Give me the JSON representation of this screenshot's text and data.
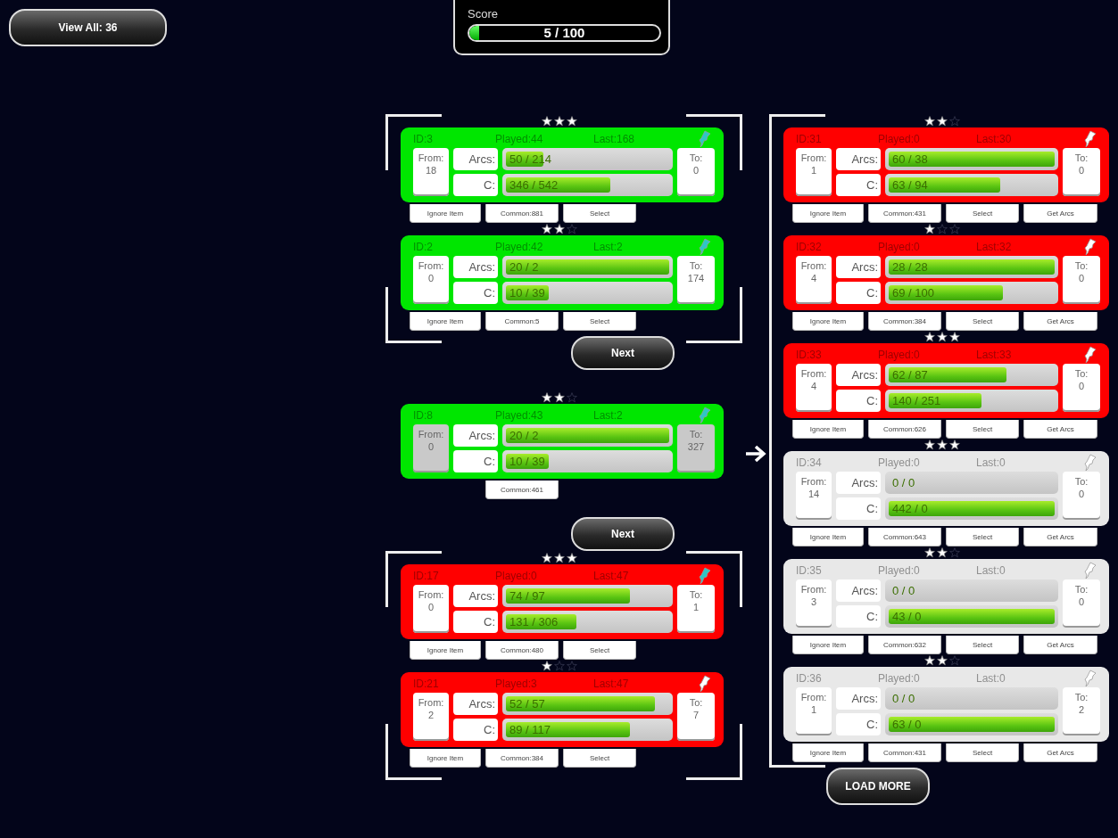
{
  "view_all_button": "View All: 36",
  "score": {
    "label": "Score",
    "text": "5 / 100",
    "level": 0.05
  },
  "left_column": [
    {
      "kind": "group",
      "cards": [
        {
          "id_text": "ID:3",
          "played": "Played:44",
          "last": "Last:168",
          "color": "#00e600",
          "pinned": true,
          "stars": 3,
          "endpoints_dimmed": false,
          "from_label": "From:",
          "from": "18",
          "arcs": {
            "label": "Arcs:",
            "text": "50 / 214",
            "level": 0.23
          },
          "c": {
            "label": "C:",
            "text": "346 / 542",
            "level": 0.64
          },
          "to_label": "To:",
          "to": "0",
          "buttons": {
            "ignore": "Ignore Item",
            "common": "Common:881",
            "select": "Select"
          }
        },
        {
          "id_text": "ID:2",
          "played": "Played:42",
          "last": "Last:2",
          "color": "#00e600",
          "pinned": true,
          "stars": 2,
          "endpoints_dimmed": false,
          "from_label": "From:",
          "from": "0",
          "arcs": {
            "label": "Arcs:",
            "text": "20 / 2",
            "level": 1
          },
          "c": {
            "label": "C:",
            "text": "10 / 39",
            "level": 0.26
          },
          "to_label": "To:",
          "to": "174",
          "buttons": {
            "ignore": "Ignore Item",
            "common": "Common:5",
            "select": "Select"
          }
        }
      ]
    },
    {
      "kind": "button",
      "label": "Next"
    },
    {
      "kind": "card",
      "card": {
        "id_text": "ID:8",
        "played": "Played:43",
        "last": "Last:2",
        "color": "#00e600",
        "pinned": true,
        "stars": 2,
        "endpoints_dimmed": true,
        "from_label": "From:",
        "from": "0",
        "arcs": {
          "label": "Arcs:",
          "text": "20 / 2",
          "level": 1
        },
        "c": {
          "label": "C:",
          "text": "10 / 39",
          "level": 0.26
        },
        "to_label": "To:",
        "to": "327",
        "buttons": {
          "common": "Common:461"
        }
      }
    },
    {
      "kind": "button",
      "label": "Next"
    },
    {
      "kind": "group",
      "cards": [
        {
          "id_text": "ID:17",
          "played": "Played:0",
          "last": "Last:47",
          "color": "#ff0000",
          "pinned": true,
          "stars": 3,
          "endpoints_dimmed": false,
          "from_label": "From:",
          "from": "0",
          "arcs": {
            "label": "Arcs:",
            "text": "74 / 97",
            "level": 0.76
          },
          "c": {
            "label": "C:",
            "text": "131 / 306",
            "level": 0.43
          },
          "to_label": "To:",
          "to": "1",
          "buttons": {
            "ignore": "Ignore Item",
            "common": "Common:480",
            "select": "Select"
          }
        },
        {
          "id_text": "ID:21",
          "played": "Played:3",
          "last": "Last:47",
          "color": "#ff0000",
          "pinned": false,
          "stars": 1,
          "endpoints_dimmed": false,
          "from_label": "From:",
          "from": "2",
          "arcs": {
            "label": "Arcs:",
            "text": "52 / 57",
            "level": 0.91
          },
          "c": {
            "label": "C:",
            "text": "89 / 117",
            "level": 0.76
          },
          "to_label": "To:",
          "to": "7",
          "buttons": {
            "ignore": "Ignore Item",
            "common": "Common:384",
            "select": "Select"
          }
        }
      ]
    }
  ],
  "right_column": {
    "cards": [
      {
        "id_text": "ID:31",
        "played": "Played:0",
        "last": "Last:30",
        "color": "#ff0000",
        "pinned": false,
        "stars": 2,
        "endpoints_dimmed": false,
        "from_label": "From:",
        "from": "1",
        "arcs": {
          "label": "Arcs:",
          "text": "60 / 38",
          "level": 1
        },
        "c": {
          "label": "C:",
          "text": "63 / 94",
          "level": 0.67
        },
        "to_label": "To:",
        "to": "0",
        "buttons": {
          "ignore": "Ignore Item",
          "common": "Common:431",
          "select": "Select",
          "get_arcs": "Get Arcs"
        }
      },
      {
        "id_text": "ID:32",
        "played": "Played:0",
        "last": "Last:32",
        "color": "#ff0000",
        "pinned": false,
        "stars": 1,
        "endpoints_dimmed": false,
        "from_label": "From:",
        "from": "4",
        "arcs": {
          "label": "Arcs:",
          "text": "28 / 28",
          "level": 1
        },
        "c": {
          "label": "C:",
          "text": "69 / 100",
          "level": 0.69
        },
        "to_label": "To:",
        "to": "0",
        "buttons": {
          "ignore": "Ignore Item",
          "common": "Common:384",
          "select": "Select",
          "get_arcs": "Get Arcs"
        }
      },
      {
        "id_text": "ID:33",
        "played": "Played:0",
        "last": "Last:33",
        "color": "#ff0000",
        "pinned": false,
        "stars": 3,
        "endpoints_dimmed": false,
        "from_label": "From:",
        "from": "4",
        "arcs": {
          "label": "Arcs:",
          "text": "62 / 87",
          "level": 0.71
        },
        "c": {
          "label": "C:",
          "text": "140 / 251",
          "level": 0.56
        },
        "to_label": "To:",
        "to": "0",
        "buttons": {
          "ignore": "Ignore Item",
          "common": "Common:626",
          "select": "Select",
          "get_arcs": "Get Arcs"
        }
      },
      {
        "id_text": "ID:34",
        "played": "Played:0",
        "last": "Last:0",
        "color": "#e8e8e8",
        "pinned": false,
        "stars": 3,
        "endpoints_dimmed": false,
        "from_label": "From:",
        "from": "14",
        "arcs": {
          "label": "Arcs:",
          "text": "0 / 0",
          "level": 0
        },
        "c": {
          "label": "C:",
          "text": "442 / 0",
          "level": 1
        },
        "to_label": "To:",
        "to": "0",
        "buttons": {
          "ignore": "Ignore Item",
          "common": "Common:643",
          "select": "Select",
          "get_arcs": "Get Arcs"
        }
      },
      {
        "id_text": "ID:35",
        "played": "Played:0",
        "last": "Last:0",
        "color": "#e8e8e8",
        "pinned": false,
        "stars": 2,
        "endpoints_dimmed": false,
        "from_label": "From:",
        "from": "3",
        "arcs": {
          "label": "Arcs:",
          "text": "0 / 0",
          "level": 0
        },
        "c": {
          "label": "C:",
          "text": "43 / 0",
          "level": 1
        },
        "to_label": "To:",
        "to": "0",
        "buttons": {
          "ignore": "Ignore Item",
          "common": "Common:632",
          "select": "Select",
          "get_arcs": "Get Arcs"
        }
      },
      {
        "id_text": "ID:36",
        "played": "Played:0",
        "last": "Last:0",
        "color": "#e8e8e8",
        "pinned": false,
        "stars": 2,
        "endpoints_dimmed": false,
        "from_label": "From:",
        "from": "1",
        "arcs": {
          "label": "Arcs:",
          "text": "0 / 0",
          "level": 0
        },
        "c": {
          "label": "C:",
          "text": "63 / 0",
          "level": 1
        },
        "to_label": "To:",
        "to": "2",
        "buttons": {
          "ignore": "Ignore Item",
          "common": "Common:431",
          "select": "Select",
          "get_arcs": "Get Arcs"
        }
      }
    ],
    "load_more_button": "LOAD MORE"
  }
}
